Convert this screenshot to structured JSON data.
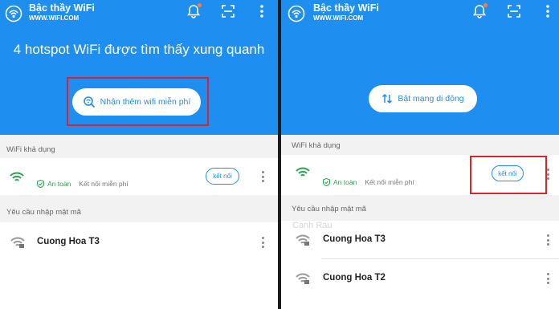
{
  "app": {
    "title": "Bậc thầy WiFi",
    "url": "WWW.WIFI.COM"
  },
  "left": {
    "headline": "4 hotspot WiFi được tìm thấy xung quanh",
    "action_button": "Nhận thêm wifi miễn phí",
    "section_available": "WiFi khả dụng",
    "available_network": {
      "safe_label": "An toàn",
      "free_label": "Kết nối miễn phí",
      "connect_label": "kết nối"
    },
    "section_password": "Yêu cầu nhập mật mã",
    "password_networks": [
      {
        "name": "Cuong Hoa T3"
      }
    ]
  },
  "right": {
    "action_button": "Bật mạng di động",
    "section_available": "WiFi khả dụng",
    "available_network": {
      "safe_label": "An toàn",
      "free_label": "Kết nối miễn phí",
      "connect_label": "kết nối"
    },
    "section_password": "Yêu cầu nhập mật mã",
    "password_networks": [
      {
        "name": "Cuong Hoa T3"
      },
      {
        "name": "Cuong Hoa T2"
      }
    ],
    "watermark": "Canh Rau"
  },
  "icons": {
    "brand": "wifi-signal-icon",
    "notification": "bell-icon",
    "scan": "qr-scan-icon",
    "menu": "more-vertical-icon",
    "search": "search-wifi-icon",
    "mobile_data": "arrows-updown-icon",
    "wifi": "wifi-icon",
    "shield": "shield-check-icon"
  },
  "colors": {
    "primary": "#1e8ff0",
    "highlight": "#d9232f",
    "safe": "#2aa64d",
    "badge": "#ff7a3d"
  }
}
